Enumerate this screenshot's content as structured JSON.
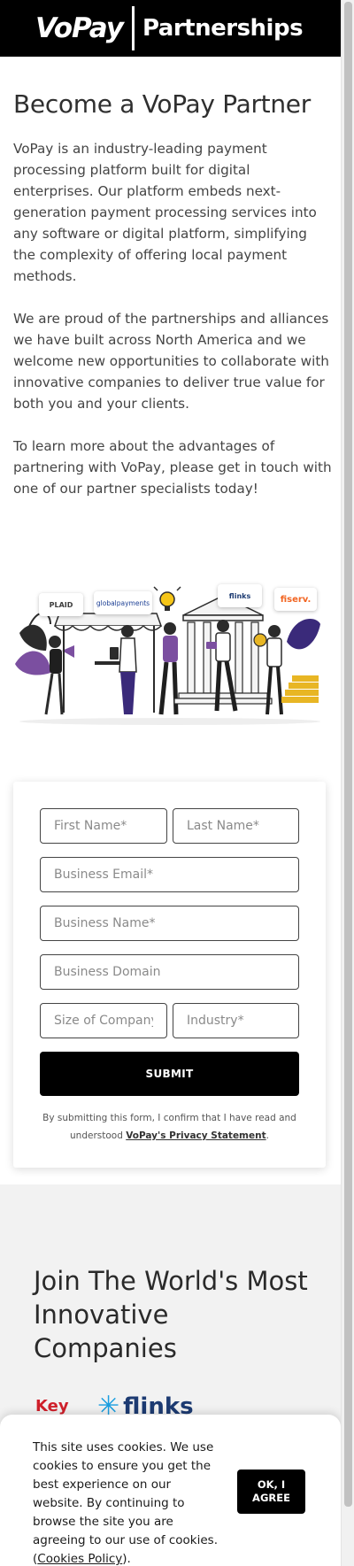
{
  "header": {
    "logo_text": "VoPay",
    "logo_subtitle": "Partnerships"
  },
  "intro": {
    "title": "Become a VoPay Partner",
    "paragraphs": [
      "VoPay is an industry-leading payment processing platform built for digital enterprises. Our platform embeds next-generation payment processing services into any software or digital platform, simplifying the complexity of offering local payment methods.",
      "We are proud of the partnerships and alliances we have built across North America and we welcome new opportunities to collaborate with innovative companies to deliver true value for both you and your clients.",
      "To learn more about the advantages of partnering with VoPay, please get in touch with one of our partner specialists today!"
    ]
  },
  "illustration": {
    "badges": [
      "PLAID",
      "globalpayments",
      "flinks",
      "fiserv."
    ]
  },
  "form": {
    "first_name_placeholder": "First Name*",
    "last_name_placeholder": "Last Name*",
    "email_placeholder": "Business Email*",
    "business_name_placeholder": "Business Name*",
    "domain_placeholder": "Business Domain",
    "company_size_placeholder": "Size of Company*",
    "industry_placeholder": "Industry*",
    "submit_label": "SUBMIT",
    "consent_prefix": "By submitting this form, I confirm that I have read and understood ",
    "consent_link": "VoPay's Privacy Statement",
    "consent_suffix": "."
  },
  "join": {
    "title": "Join The World's Most Innovative Companies",
    "logos": [
      "Key",
      "flinks"
    ]
  },
  "cookie": {
    "text": "This site uses cookies. We use cookies to ensure you get the best experience on our website. By continuing to browse the site you are agreeing to our use of cookies. (",
    "link": "Cookies Policy",
    "text_end": ").",
    "button_label": "OK, I AGREE"
  },
  "colors": {
    "header_bg": "#000000",
    "accent_purple": "#7b4fa0",
    "accent_gold": "#e8b624",
    "section_bg": "#f2f2f2"
  }
}
